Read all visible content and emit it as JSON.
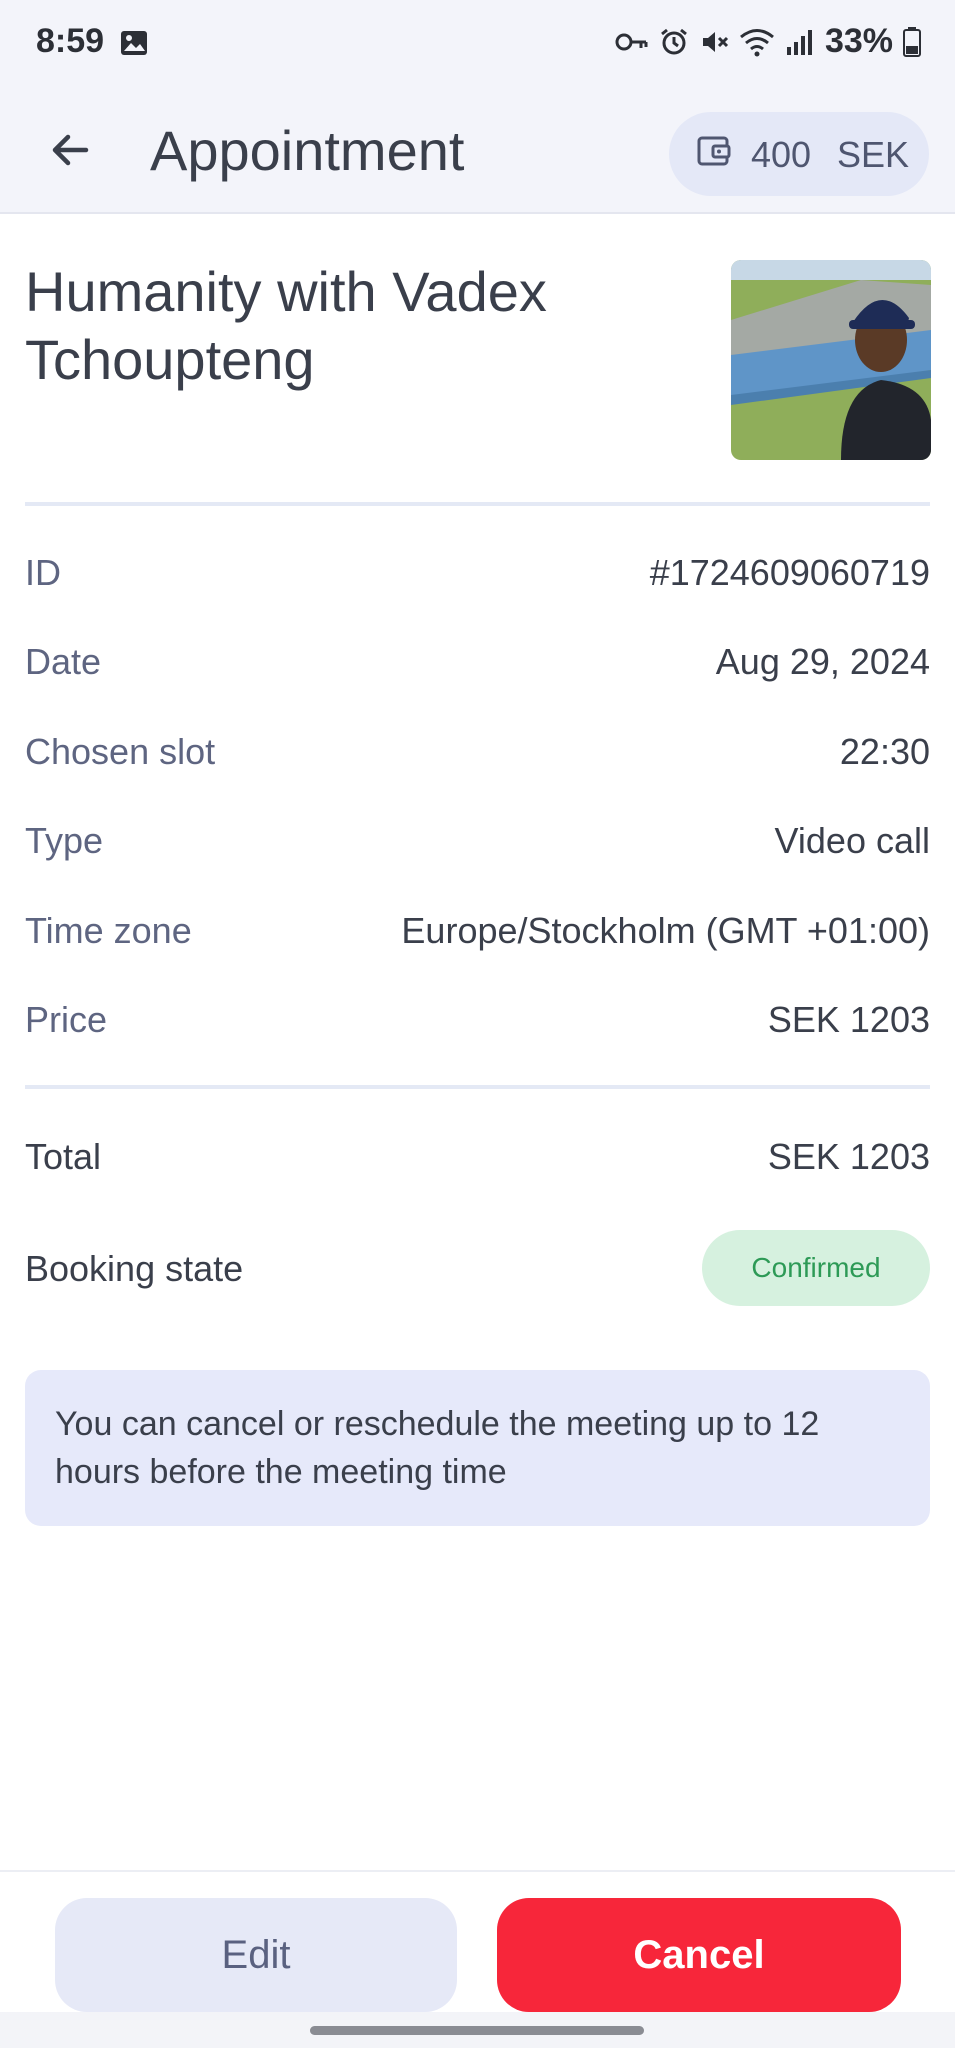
{
  "status_bar": {
    "time": "8:59",
    "battery": "33%",
    "icons": [
      "image-icon",
      "key-icon",
      "alarm-icon",
      "mute-icon",
      "wifi-icon",
      "signal-icon",
      "battery-icon"
    ]
  },
  "app_bar": {
    "title": "Appointment",
    "wallet_amount": "400",
    "wallet_currency": "SEK"
  },
  "meeting": {
    "title": "Humanity with Vadex Tchoupteng"
  },
  "details": [
    {
      "label": "ID",
      "value": "#1724609060719"
    },
    {
      "label": "Date",
      "value": "Aug 29, 2024"
    },
    {
      "label": "Chosen slot",
      "value": "22:30"
    },
    {
      "label": "Type",
      "value": "Video call"
    },
    {
      "label": "Time zone",
      "value": "Europe/Stockholm (GMT +01:00)"
    },
    {
      "label": "Price",
      "value": "SEK 1203"
    }
  ],
  "total": {
    "label": "Total",
    "value": "SEK 1203"
  },
  "booking_state": {
    "label": "Booking state",
    "value": "Confirmed",
    "color": "#2d9a56"
  },
  "notice": "You can cancel or reschedule the meeting up to 12 hours before the meeting time",
  "actions": {
    "edit_label": "Edit",
    "cancel_label": "Cancel"
  },
  "colors": {
    "accent": "#f7263a",
    "app_bar_bg": "#f3f4fa",
    "notice_bg": "#e6e9fa"
  }
}
